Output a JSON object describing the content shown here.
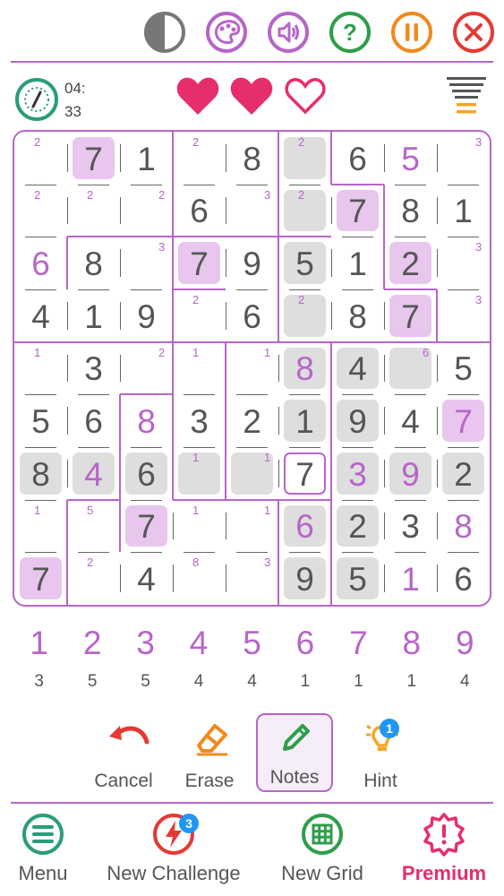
{
  "top_icons": [
    "contrast-icon",
    "palette-icon",
    "sound-icon",
    "help-icon",
    "pause-icon",
    "close-icon"
  ],
  "timer": {
    "minutes": "04:",
    "seconds": "33"
  },
  "lives": {
    "filled": 2,
    "total": 3
  },
  "colors": {
    "accent": "#b765c9",
    "heart": "#e62e6b",
    "green": "#2a9d7a",
    "orange": "#f39c12",
    "red": "#e53935",
    "blue": "#2196f3",
    "given": "#555555",
    "user": "#b765c9",
    "gray_box": "#dedede",
    "pink_box": "#e8c6ee"
  },
  "board": {
    "values": [
      [
        "",
        "7",
        "1",
        "",
        "8",
        "",
        "6",
        "5",
        ""
      ],
      [
        "",
        "",
        "",
        "6",
        "",
        "",
        "7",
        "8",
        "1"
      ],
      [
        "6",
        "8",
        "",
        "7",
        "9",
        "5",
        "1",
        "2",
        ""
      ],
      [
        "4",
        "1",
        "9",
        "",
        "6",
        "",
        "8",
        "7",
        ""
      ],
      [
        "",
        "3",
        "",
        "",
        "",
        "8",
        "4",
        "",
        "5"
      ],
      [
        "5",
        "6",
        "8",
        "3",
        "2",
        "1",
        "9",
        "4",
        "7"
      ],
      [
        "8",
        "4",
        "6",
        "",
        "",
        "7",
        "3",
        "9",
        "2"
      ],
      [
        "",
        "",
        "7",
        "",
        "",
        "6",
        "2",
        "3",
        "8"
      ],
      [
        "7",
        "",
        "4",
        "",
        "",
        "9",
        "5",
        "1",
        "6"
      ]
    ],
    "user_cells": [
      [
        0,
        7
      ],
      [
        2,
        0
      ],
      [
        4,
        5
      ],
      [
        5,
        2
      ],
      [
        5,
        8
      ],
      [
        6,
        1
      ],
      [
        6,
        6
      ],
      [
        6,
        7
      ],
      [
        7,
        5
      ],
      [
        7,
        8
      ],
      [
        8,
        7
      ]
    ],
    "pink_cells": [
      [
        0,
        1
      ],
      [
        1,
        6
      ],
      [
        2,
        3
      ],
      [
        2,
        7
      ],
      [
        3,
        7
      ],
      [
        5,
        8
      ],
      [
        7,
        2
      ],
      [
        8,
        0
      ]
    ],
    "gray_cells": [
      [
        0,
        5
      ],
      [
        1,
        5
      ],
      [
        2,
        5
      ],
      [
        3,
        5
      ],
      [
        4,
        5
      ],
      [
        4,
        6
      ],
      [
        4,
        7
      ],
      [
        5,
        5
      ],
      [
        5,
        6
      ],
      [
        6,
        0
      ],
      [
        6,
        1
      ],
      [
        6,
        2
      ],
      [
        6,
        3
      ],
      [
        6,
        4
      ],
      [
        6,
        6
      ],
      [
        6,
        7
      ],
      [
        6,
        8
      ],
      [
        7,
        5
      ],
      [
        7,
        6
      ],
      [
        8,
        5
      ],
      [
        8,
        6
      ]
    ],
    "selected_cell": [
      6,
      5
    ],
    "cage_sums": [
      {
        "r": 0,
        "c": 0,
        "v": "2"
      },
      {
        "r": 0,
        "c": 3,
        "v": "2"
      },
      {
        "r": 0,
        "c": 5,
        "v": "2"
      },
      {
        "r": 0,
        "c": 8,
        "v": "3"
      },
      {
        "r": 1,
        "c": 0,
        "v": "2"
      },
      {
        "r": 1,
        "c": 1,
        "v": "2"
      },
      {
        "r": 1,
        "c": 2,
        "v": "2"
      },
      {
        "r": 1,
        "c": 4,
        "v": "3"
      },
      {
        "r": 1,
        "c": 5,
        "v": "2"
      },
      {
        "r": 2,
        "c": 2,
        "v": "3"
      },
      {
        "r": 2,
        "c": 8,
        "v": "3"
      },
      {
        "r": 3,
        "c": 3,
        "v": "2"
      },
      {
        "r": 3,
        "c": 5,
        "v": "2"
      },
      {
        "r": 3,
        "c": 8,
        "v": "3"
      },
      {
        "r": 4,
        "c": 0,
        "v": "1"
      },
      {
        "r": 4,
        "c": 2,
        "v": "2"
      },
      {
        "r": 4,
        "c": 3,
        "v": "1"
      },
      {
        "r": 4,
        "c": 4,
        "v": "1"
      },
      {
        "r": 4,
        "c": 7,
        "v": "6"
      },
      {
        "r": 6,
        "c": 3,
        "v": "1"
      },
      {
        "r": 6,
        "c": 4,
        "v": "1"
      },
      {
        "r": 7,
        "c": 0,
        "v": "1"
      },
      {
        "r": 7,
        "c": 1,
        "v": "5"
      },
      {
        "r": 7,
        "c": 3,
        "v": "1"
      },
      {
        "r": 7,
        "c": 4,
        "v": "1"
      },
      {
        "r": 8,
        "c": 1,
        "v": "2"
      },
      {
        "r": 8,
        "c": 3,
        "v": "8"
      },
      {
        "r": 8,
        "c": 4,
        "v": "3"
      }
    ]
  },
  "numpad": [
    {
      "digit": "1",
      "count": "3"
    },
    {
      "digit": "2",
      "count": "5"
    },
    {
      "digit": "3",
      "count": "5"
    },
    {
      "digit": "4",
      "count": "4"
    },
    {
      "digit": "5",
      "count": "4"
    },
    {
      "digit": "6",
      "count": "1"
    },
    {
      "digit": "7",
      "count": "1"
    },
    {
      "digit": "8",
      "count": "1"
    },
    {
      "digit": "9",
      "count": "4"
    }
  ],
  "tools": {
    "cancel": "Cancel",
    "erase": "Erase",
    "notes": "Notes",
    "hint": "Hint",
    "hint_badge": "1"
  },
  "nav": {
    "menu": "Menu",
    "new_challenge": "New Challenge",
    "challenge_badge": "3",
    "new_grid": "New Grid",
    "premium": "Premium"
  }
}
